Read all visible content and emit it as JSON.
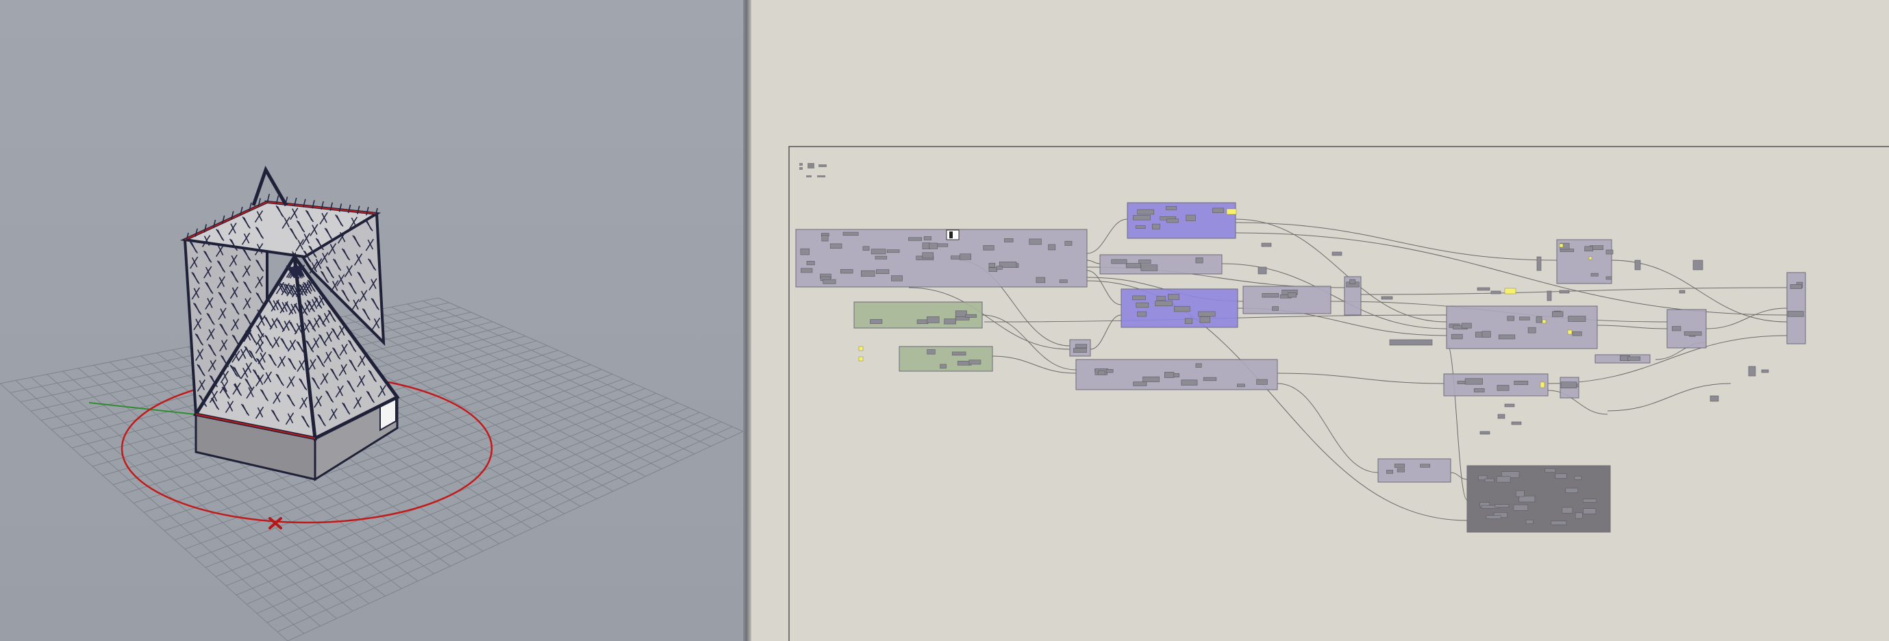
{
  "viewport": {
    "grid_color": "#7e848c",
    "background": "#9ea2aa",
    "building_line": "#1e2138",
    "circle_color": "#c21a1a",
    "gumball_marker": "close-icon"
  },
  "canvas": {
    "background": "#d9d6ce",
    "group_colors": {
      "gray": "#aca9bd",
      "blue": "#8f86e0",
      "green": "#a6b897",
      "dark": "#6e6d72"
    },
    "wire_color": "#6a6a6a",
    "panel_color": "#f7f06e"
  }
}
